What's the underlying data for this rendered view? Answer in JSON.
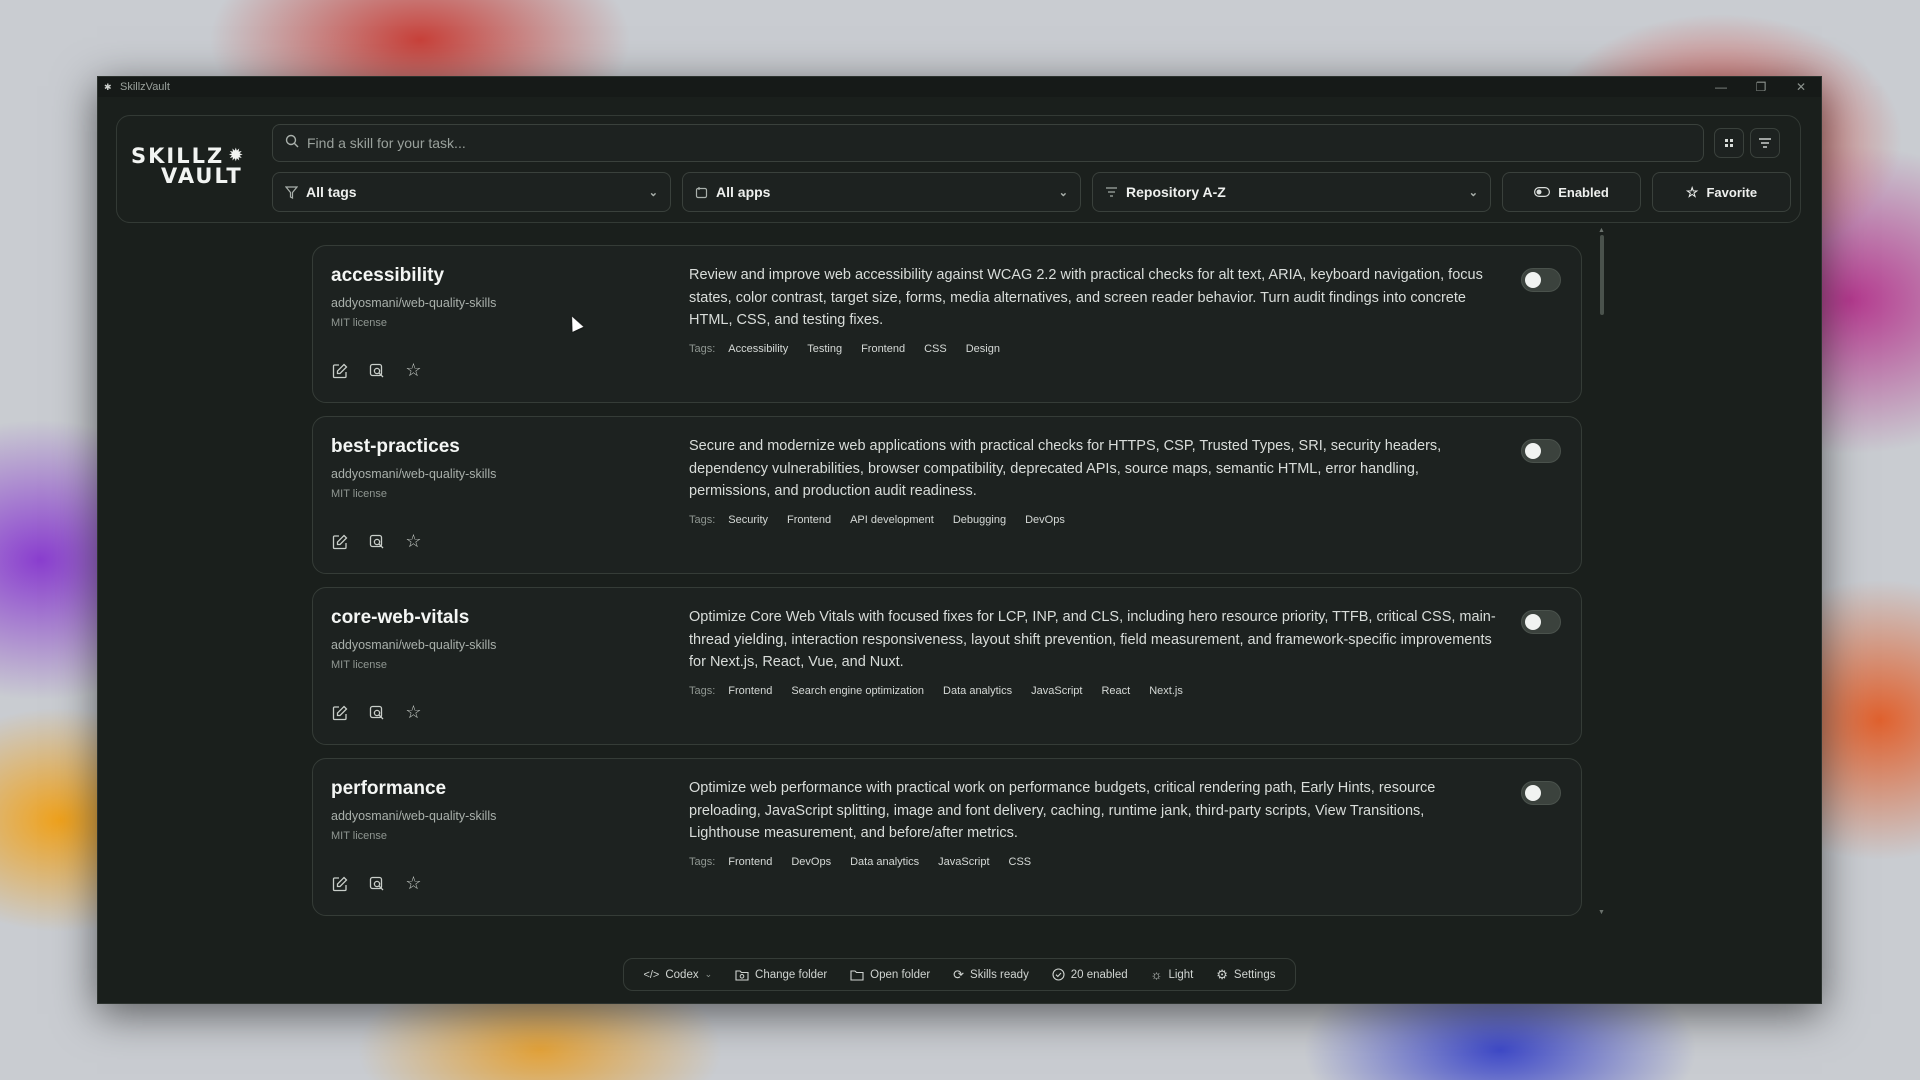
{
  "window": {
    "title": "SkillzVault",
    "controls": [
      "—",
      "❐",
      "✕"
    ]
  },
  "logo": {
    "line1": "SKILLZ",
    "line2": "VAULT"
  },
  "search": {
    "placeholder": "Find a skill for your task..."
  },
  "filters": {
    "tags": "All tags",
    "apps": "All apps",
    "sort": "Repository A-Z",
    "enabled_label": "Enabled",
    "favorite_label": "Favorite"
  },
  "skills": [
    {
      "name": "accessibility",
      "repo": "addyosmani/web-quality-skills",
      "license": "MIT license",
      "description": "Review and improve web accessibility against WCAG 2.2 with practical checks for alt text, ARIA, keyboard navigation, focus states, color contrast, target size, forms, media alternatives, and screen reader behavior. Turn audit findings into concrete HTML, CSS, and testing fixes.",
      "tags_label": "Tags:",
      "tags": [
        "Accessibility",
        "Testing",
        "Frontend",
        "CSS",
        "Design"
      ],
      "enabled": false
    },
    {
      "name": "best-practices",
      "repo": "addyosmani/web-quality-skills",
      "license": "MIT license",
      "description": "Secure and modernize web applications with practical checks for HTTPS, CSP, Trusted Types, SRI, security headers, dependency vulnerabilities, browser compatibility, deprecated APIs, source maps, semantic HTML, error handling, permissions, and production audit readiness.",
      "tags_label": "Tags:",
      "tags": [
        "Security",
        "Frontend",
        "API development",
        "Debugging",
        "DevOps"
      ],
      "enabled": false
    },
    {
      "name": "core-web-vitals",
      "repo": "addyosmani/web-quality-skills",
      "license": "MIT license",
      "description": "Optimize Core Web Vitals with focused fixes for LCP, INP, and CLS, including hero resource priority, TTFB, critical CSS, main-thread yielding, interaction responsiveness, layout shift prevention, field measurement, and framework-specific improvements for Next.js, React, Vue, and Nuxt.",
      "tags_label": "Tags:",
      "tags": [
        "Frontend",
        "Search engine optimization",
        "Data analytics",
        "JavaScript",
        "React",
        "Next.js"
      ],
      "enabled": false
    },
    {
      "name": "performance",
      "repo": "addyosmani/web-quality-skills",
      "license": "MIT license",
      "description": "Optimize web performance with practical work on performance budgets, critical rendering path, Early Hints, resource preloading, JavaScript splitting, image and font delivery, caching, runtime jank, third-party scripts, View Transitions, Lighthouse measurement, and before/after metrics.",
      "tags_label": "Tags:",
      "tags": [
        "Frontend",
        "DevOps",
        "Data analytics",
        "JavaScript",
        "CSS"
      ],
      "enabled": false
    }
  ],
  "statusbar": {
    "agent": "Codex",
    "change_folder": "Change folder",
    "open_folder": "Open folder",
    "skills_status": "Skills ready",
    "enabled_count": "20 enabled",
    "theme": "Light",
    "settings": "Settings"
  }
}
